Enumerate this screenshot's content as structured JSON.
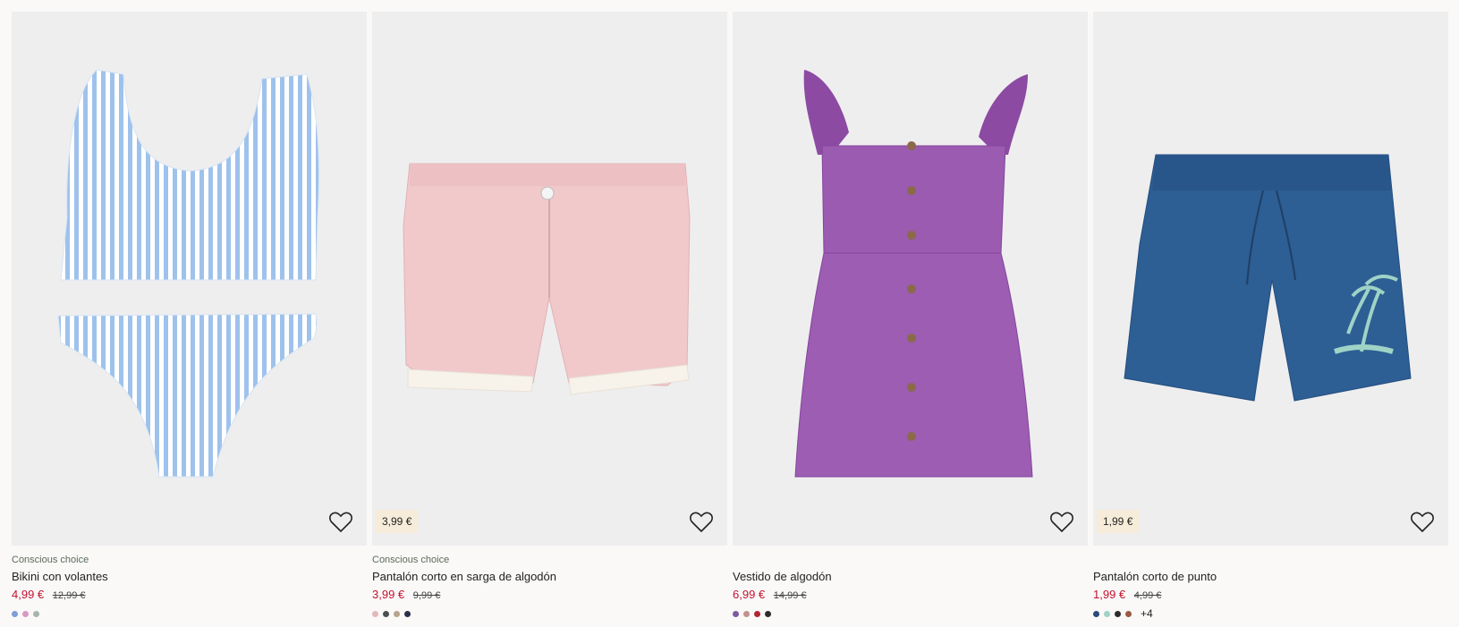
{
  "products": [
    {
      "eco_label": "Conscious choice",
      "title": "Bikini con volantes",
      "price_now": "4,99 €",
      "price_old": "12,99 €",
      "price_tag": "",
      "swatches": [
        "#7f9ed8",
        "#d998c3",
        "#a6b5ad"
      ],
      "more_colors": ""
    },
    {
      "eco_label": "Conscious choice",
      "title": "Pantalón corto en sarga de algodón",
      "price_now": "3,99 €",
      "price_old": "9,99 €",
      "price_tag": "3,99 €",
      "swatches": [
        "#e2b9bb",
        "#4c514f",
        "#b7a48c",
        "#2b2f48"
      ],
      "more_colors": ""
    },
    {
      "eco_label": "",
      "title": "Vestido de algodón",
      "price_now": "6,99 €",
      "price_old": "14,99 €",
      "price_tag": "",
      "swatches": [
        "#7e5aa0",
        "#c49190",
        "#b3242f",
        "#2c2c2c"
      ],
      "more_colors": ""
    },
    {
      "eco_label": "",
      "title": "Pantalón corto de punto",
      "price_now": "1,99 €",
      "price_old": "4,99 €",
      "price_tag": "1,99 €",
      "swatches": [
        "#2b4a7a",
        "#9ed3c6",
        "#2c2c2c",
        "#9b5a45"
      ],
      "more_colors": "+4"
    }
  ],
  "colors": {
    "sale_price": "#c4122f",
    "price_tag_bg": "#f6ecd9",
    "image_bg": "#eeeeef"
  },
  "icons": {
    "favorite": "heart-outline-icon"
  }
}
